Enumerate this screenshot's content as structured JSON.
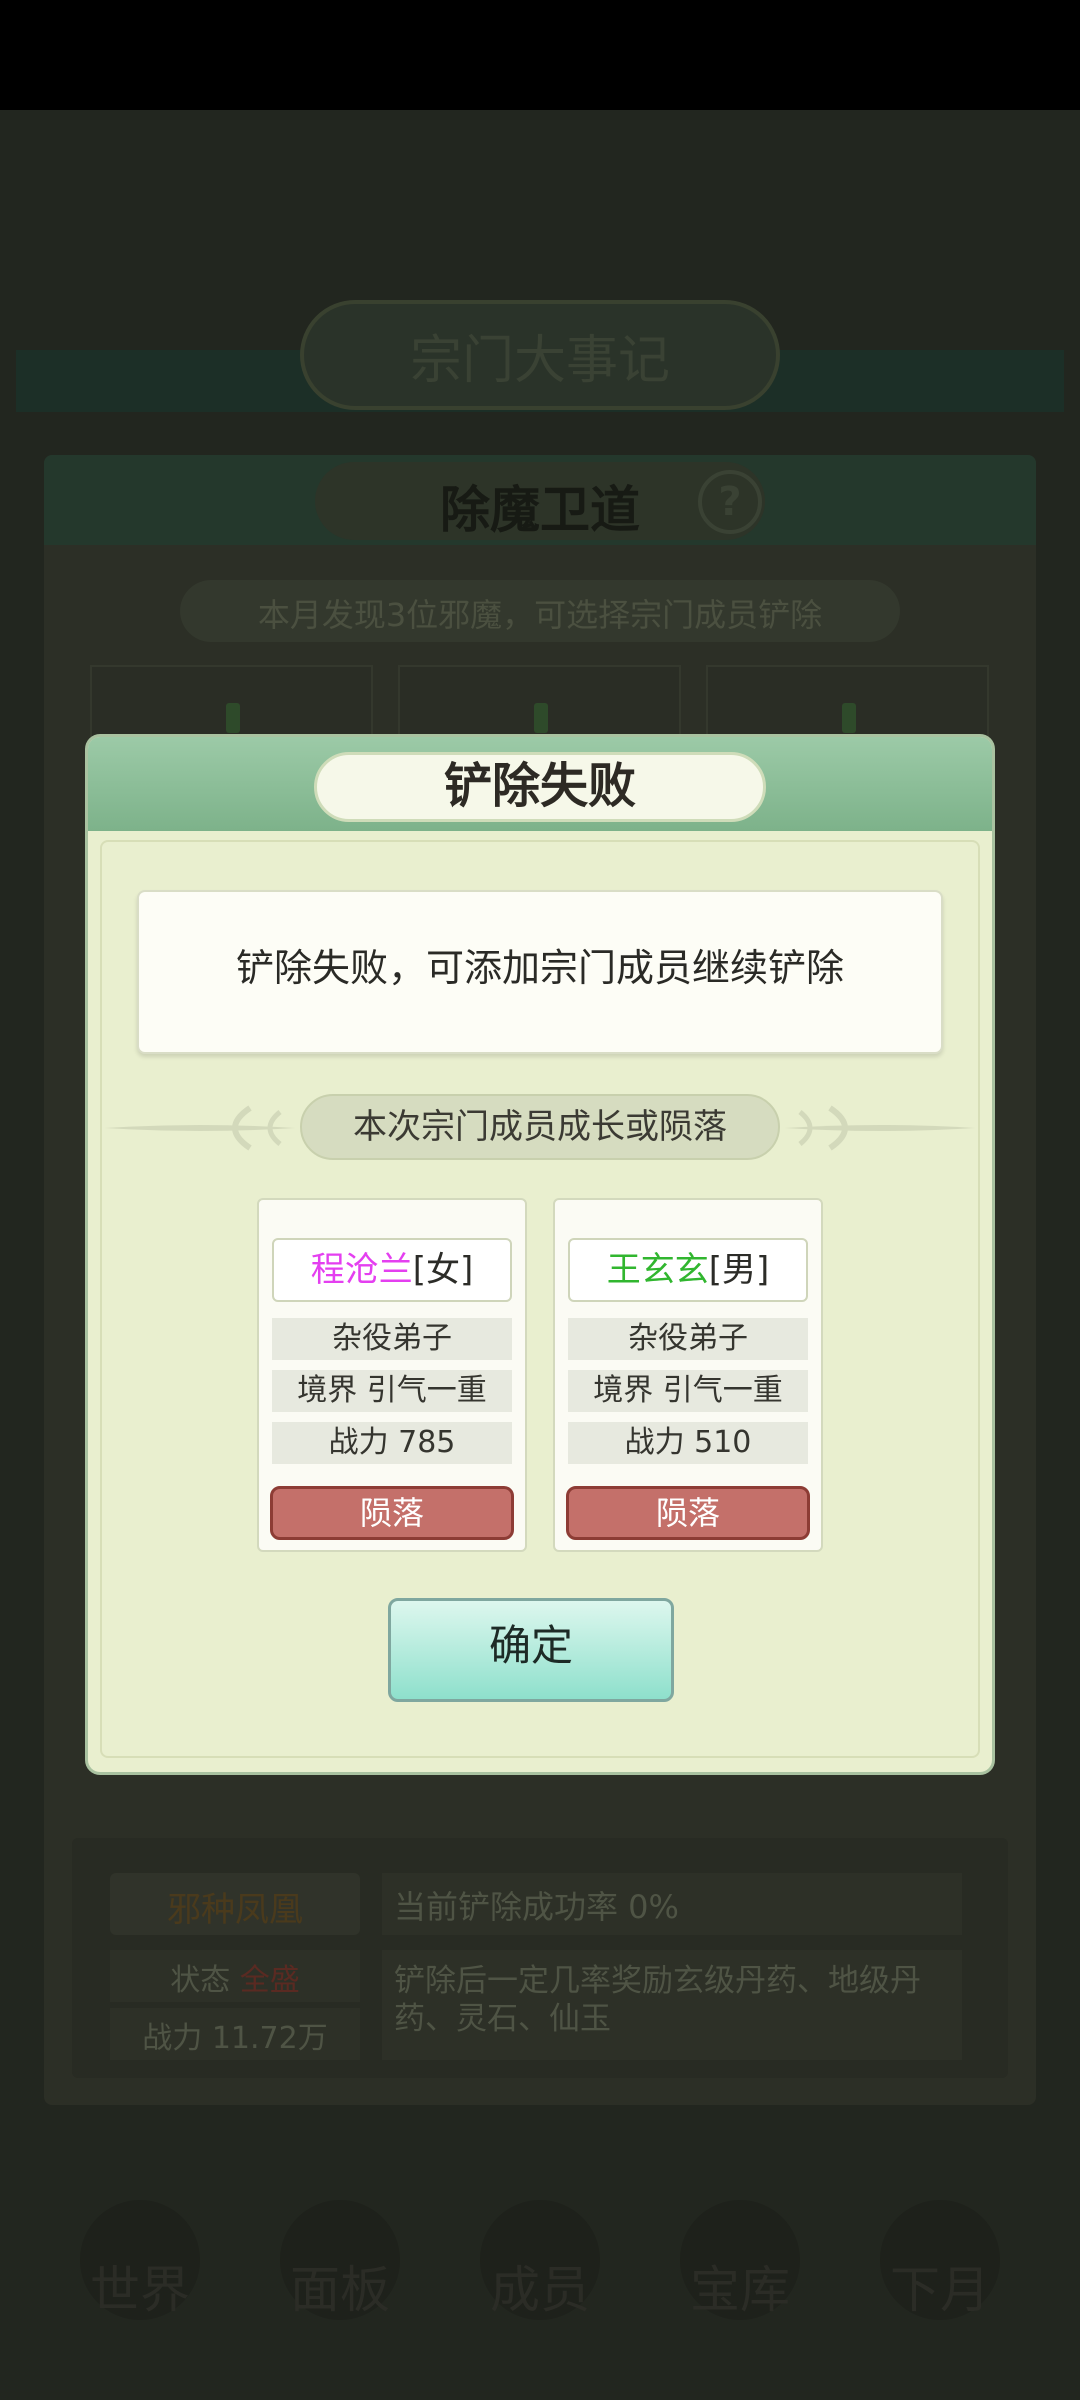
{
  "background": {
    "banner_title": "宗门大事记",
    "panel_title": "除魔卫道",
    "help_symbol": "?",
    "found_text": "本月发现3位邪魔，可选择宗门成员铲除",
    "demon_name": "邪种凤凰",
    "success_rate": "当前铲除成功率 0%",
    "state_label": "状态",
    "state_value": "全盛",
    "power": "战力 11.72万",
    "reward_text": "铲除后一定几率奖励玄级丹药、地级丹药、灵石、仙玉",
    "nav": [
      "世界",
      "面板",
      "成员",
      "宝库",
      "下月"
    ]
  },
  "dialog": {
    "title": "铲除失败",
    "message": "铲除失败，可添加宗门成员继续铲除",
    "section_label": "本次宗门成员成长或陨落",
    "members": [
      {
        "name": "程沧兰",
        "gender": "[女]",
        "name_color": "#e43ff0",
        "role": "杂役弟子",
        "realm": "境界 引气一重",
        "power": "战力 785",
        "status": "陨落"
      },
      {
        "name": "王玄玄",
        "gender": "[男]",
        "name_color": "#31b62f",
        "role": "杂役弟子",
        "realm": "境界 引气一重",
        "power": "战力 510",
        "status": "陨落"
      }
    ],
    "confirm_label": "确定"
  }
}
